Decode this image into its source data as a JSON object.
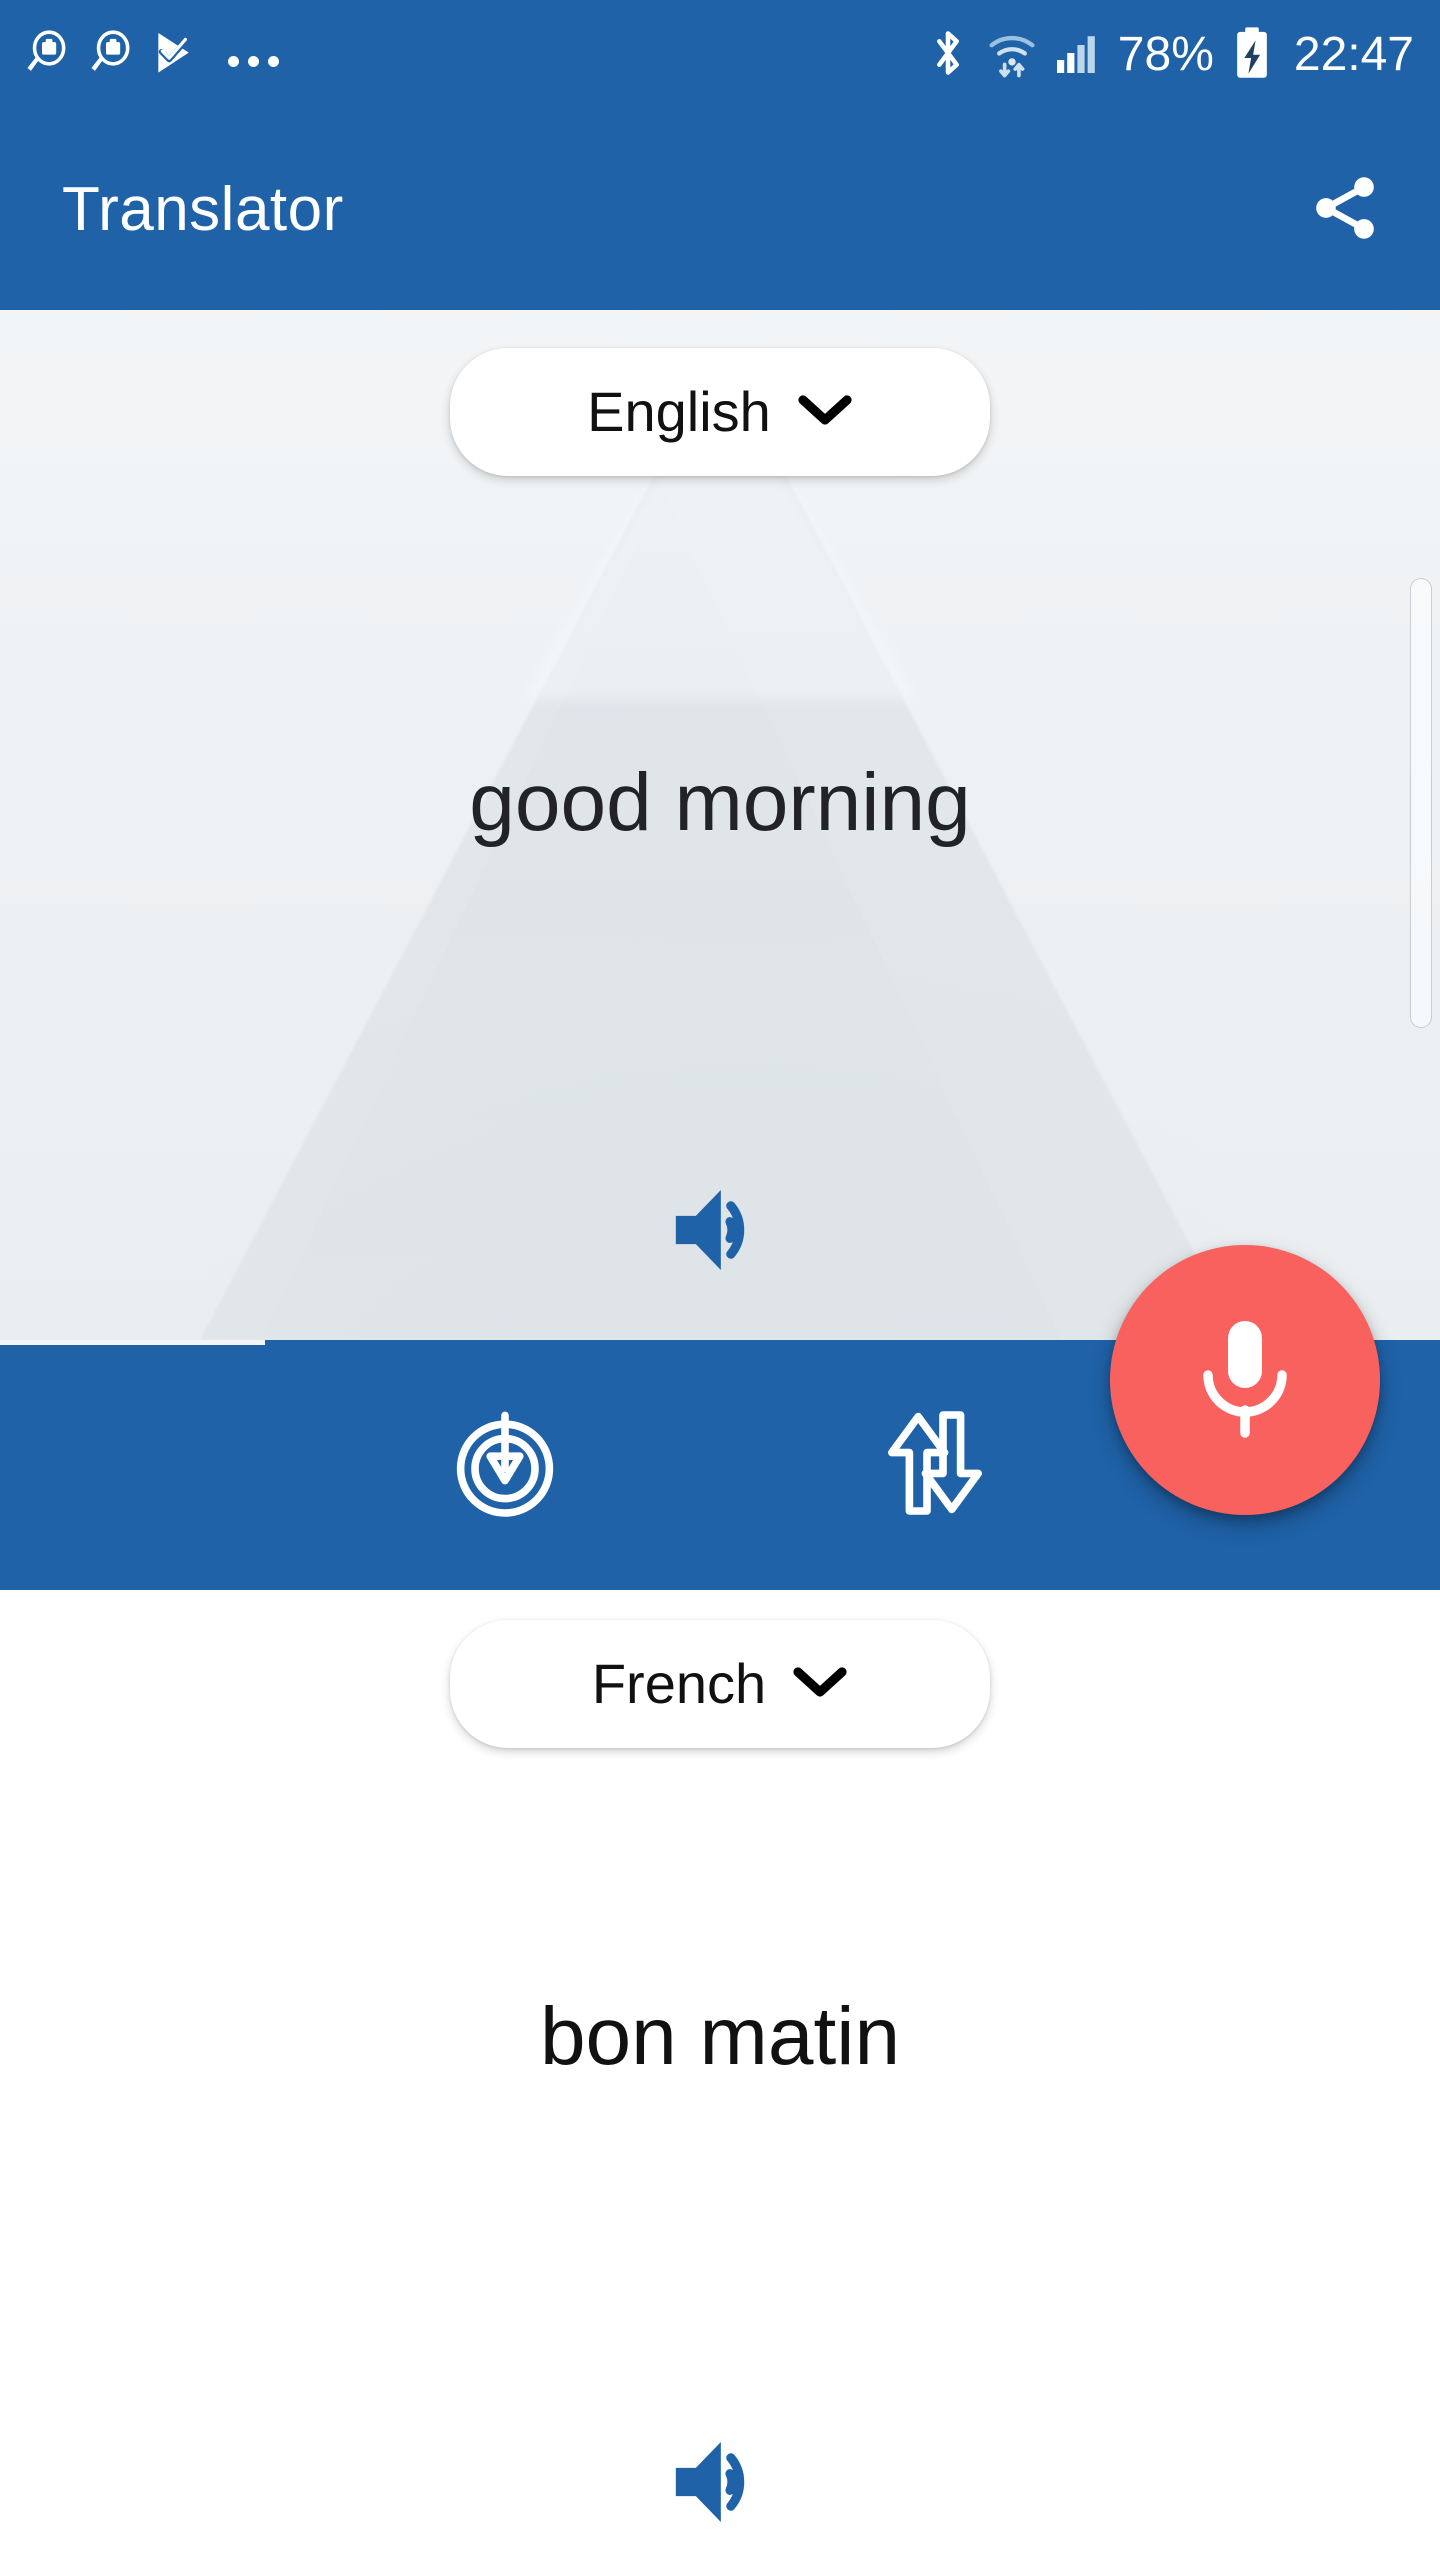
{
  "status_bar": {
    "notification_icons": [
      {
        "name": "job-search-icon"
      },
      {
        "name": "job-search-icon"
      },
      {
        "name": "play-store-check-icon"
      },
      {
        "name": "more-notifications-icon"
      }
    ],
    "bluetooth_icon": "bluetooth-icon",
    "wifi_icon": "wifi-icon",
    "signal_icon": "cellular-signal-icon",
    "battery_percent": "78%",
    "battery_icon": "battery-charging-icon",
    "clock": "22:47"
  },
  "app_bar": {
    "title": "Translator",
    "share_icon": "share-icon"
  },
  "source": {
    "language": "English",
    "chevron_icon": "chevron-down-icon",
    "text": "good morning",
    "speaker_icon": "speak-icon"
  },
  "toolbar": {
    "save_icon": "download-to-circle-icon",
    "swap_icon": "swap-languages-icon",
    "mic_icon": "microphone-icon"
  },
  "target": {
    "language": "French",
    "chevron_icon": "chevron-down-icon",
    "text": "bon matin",
    "speaker_icon": "speak-icon"
  },
  "colors": {
    "primary_blue": "#1F62A8",
    "mic_red": "#F9615F",
    "speaker_blue": "#1F62A8",
    "panel_white": "#FFFFFF"
  }
}
